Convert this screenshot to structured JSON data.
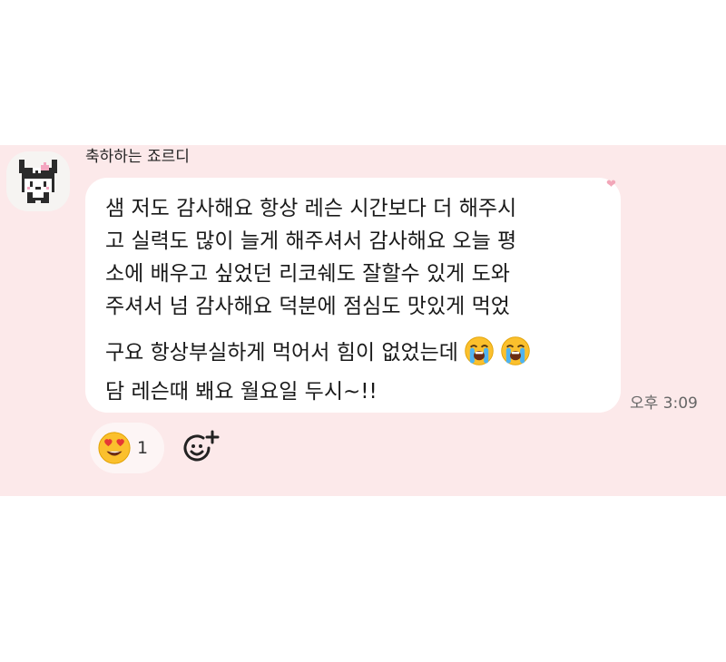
{
  "message": {
    "sender": "축하하는 죠르디",
    "lines": [
      "샘 저도 감사해요 항상 레슨 시간보다 더 해주시",
      "고 실력도 많이 늘게 해주셔서 감사해요 오늘 평",
      "소에 배우고 싶었던 리코쉐도 잘할수 있게 도와",
      "주셔서 넘 감사해요 덕분에 점심도 맛있게 먹었",
      "구요 항상부실하게 먹어서 힘이 없었는데",
      "담 레슨때 봬요 월요일 두시~!!"
    ],
    "inline_emojis": [
      "loudly-crying-face",
      "loudly-crying-face"
    ],
    "timestamp": "오후 3:09"
  },
  "reactions": [
    {
      "emoji": "smiling-face-with-heart-eyes",
      "count": "1"
    }
  ],
  "colors": {
    "chat_background": "#fce9ea",
    "bubble": "#ffffff",
    "heart_accent": "#f2a6b8"
  }
}
